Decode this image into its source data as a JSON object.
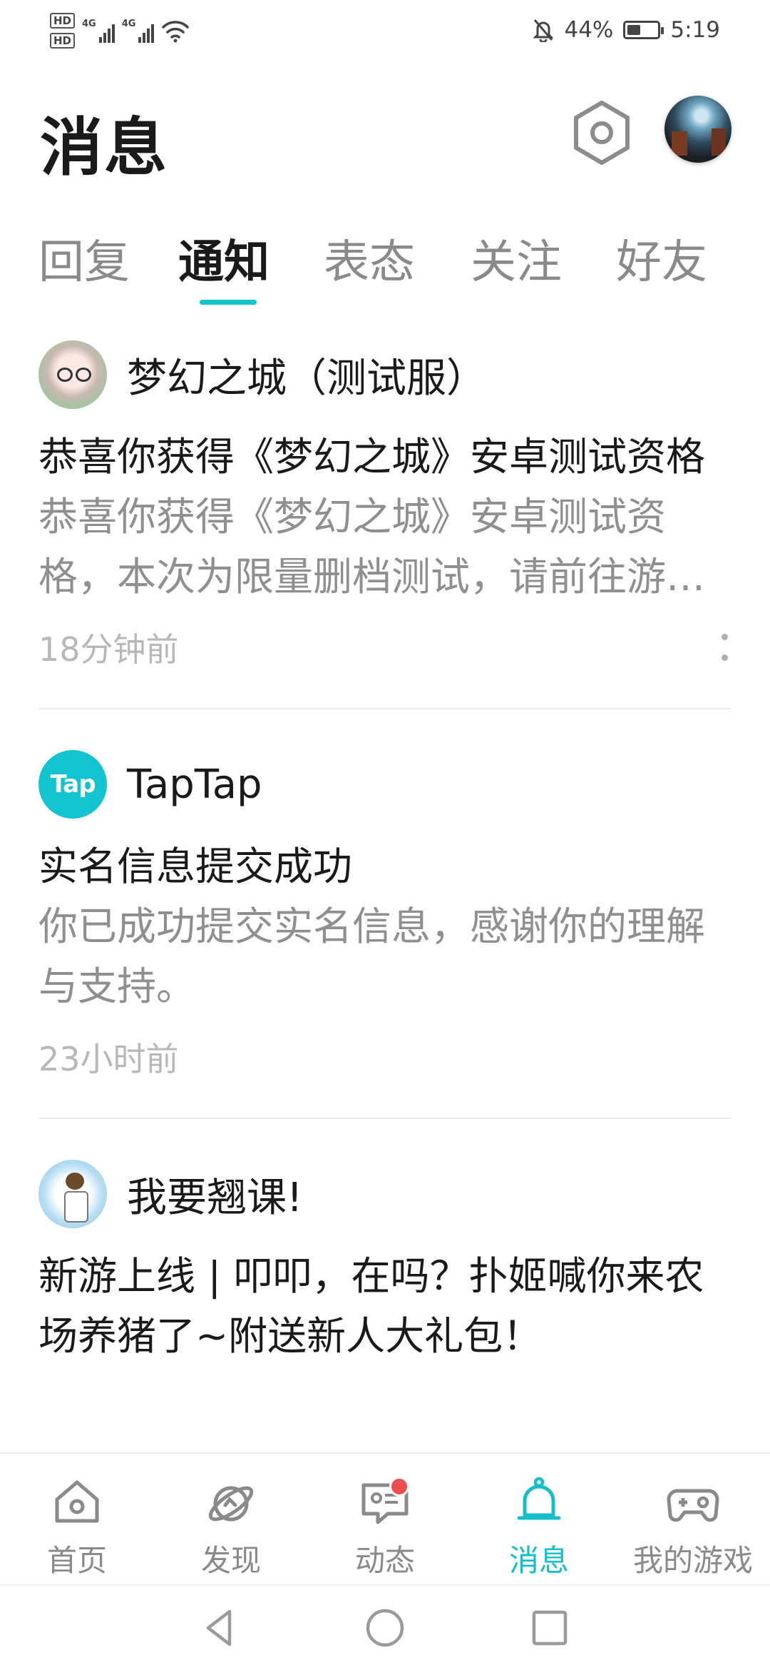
{
  "status_bar": {
    "hd1": "HD",
    "hd2": "HD",
    "network1": "4G",
    "network2": "4G",
    "battery_percent": "44%",
    "battery_level": 0.44,
    "time": "5:19"
  },
  "header": {
    "title": "消息"
  },
  "tabs": [
    {
      "label": "回复",
      "active": false
    },
    {
      "label": "通知",
      "active": true
    },
    {
      "label": "表态",
      "active": false
    },
    {
      "label": "关注",
      "active": false
    },
    {
      "label": "好友",
      "active": false
    }
  ],
  "notifications": [
    {
      "sender": "梦幻之城（测试服）",
      "title": "恭喜你获得《梦幻之城》安卓测试资格",
      "body": "恭喜你获得《梦幻之城》安卓测试资格，本次为限量删档测试，请前往游戏详情页查看测试时间",
      "time": "18分钟前"
    },
    {
      "sender": "TapTap",
      "avatar_text": "Tap",
      "title": "实名信息提交成功",
      "body": "你已成功提交实名信息，感谢你的理解与支持。",
      "time": "23小时前"
    },
    {
      "sender": "我要翘课!",
      "title": "新游上线 | 叩叩，在吗？扑姬喊你来农场养猪了~附送新人大礼包！",
      "body": "",
      "time": ""
    }
  ],
  "bottom_nav": [
    {
      "label": "首页",
      "icon": "home-icon",
      "active": false
    },
    {
      "label": "发现",
      "icon": "discover-icon",
      "active": false
    },
    {
      "label": "动态",
      "icon": "feed-icon",
      "active": false,
      "badge": true
    },
    {
      "label": "消息",
      "icon": "bell-icon",
      "active": true
    },
    {
      "label": "我的游戏",
      "icon": "gamepad-icon",
      "active": false
    }
  ],
  "colors": {
    "accent": "#15c5ce",
    "badge": "#ef4d4d",
    "muted_text": "#8f8f8f",
    "time_text": "#b8b8b8"
  }
}
